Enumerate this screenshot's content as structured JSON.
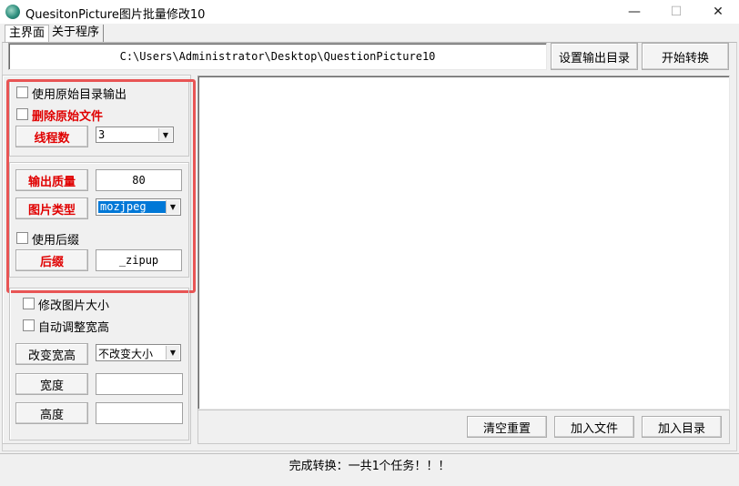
{
  "window": {
    "title": "QuesitonPicture图片批量修改10",
    "minimize": "—",
    "maximize": "☐",
    "close": "✕"
  },
  "tabs": [
    {
      "label": "主界面"
    },
    {
      "label": "关于程序"
    }
  ],
  "header": {
    "path": "C:\\Users\\Administrator\\Desktop\\QuestionPicture10",
    "set_output_button": "设置输出目录",
    "start_button": "开始转换"
  },
  "options": {
    "use_original_dir": "使用原始目录输出",
    "delete_original": "删除原始文件",
    "threads_button": "线程数",
    "threads_value": "3",
    "quality_button": "输出质量",
    "quality_value": "80",
    "type_button": "图片类型",
    "type_value": "mozjpeg",
    "use_suffix": "使用后缀",
    "suffix_button": "后缀",
    "suffix_value": "_zipup"
  },
  "resize": {
    "modify_size": "修改图片大小",
    "auto_adjust": "自动调整宽高",
    "change_button": "改变宽高",
    "change_value": "不改变大小",
    "width_button": "宽度",
    "width_value": "",
    "height_button": "高度",
    "height_value": ""
  },
  "file_actions": {
    "clear_button": "清空重置",
    "add_file_button": "加入文件",
    "add_dir_button": "加入目录"
  },
  "status": {
    "text": "完成转换：一共1个任务！！！"
  },
  "colors": {
    "accent_red": "#e00000",
    "highlight_box": "#e85555",
    "selection_blue": "#0078d7"
  }
}
